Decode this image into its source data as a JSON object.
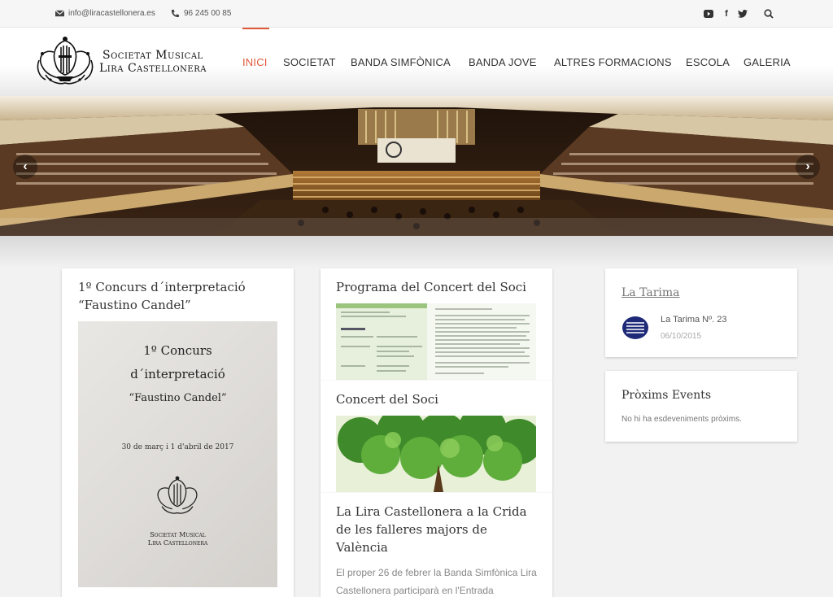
{
  "topbar": {
    "email": "info@liracastellonera.es",
    "phone": "96 245 00 85",
    "icons": [
      "youtube-icon",
      "facebook-icon",
      "twitter-icon",
      "search-icon"
    ]
  },
  "logo": {
    "line1": "Societat Musical",
    "line2": "Lira Castellonera"
  },
  "nav": {
    "items": [
      "INICI",
      "SOCIETAT",
      "BANDA SIMFÒNICA",
      "BANDA JOVE",
      "ALTRES FORMACIONS",
      "ESCOLA",
      "GALERIA"
    ],
    "active_color": "#e0583b"
  },
  "posts": {
    "concurs": {
      "title": "1º Concurs d´interpretació “Faustino Candel”",
      "poster": {
        "line1": "1º Concurs",
        "line2": "d´interpretació",
        "line3": "“Faustino Candel”",
        "dates": "30 de març i 1 d'abril de 2017",
        "org1": "Societat Musical",
        "org2": "Lira Castellonera"
      }
    },
    "programa": {
      "title": "Programa del Concert del Soci"
    },
    "concert": {
      "title": "Concert del Soci"
    },
    "crida": {
      "title": "La Lira Castellonera a la Crida de les falleres majors de València",
      "excerpt": "El proper 26 de febrer la Banda Simfònica Lira Castellonera participarà en l'Entrada"
    }
  },
  "sidebar": {
    "tarima": {
      "title": "La Tarima",
      "item_title": "La Tarima Nº. 23",
      "item_date": "06/10/2015"
    },
    "events": {
      "title": "Pròxims Events",
      "empty": "No hi ha esdeveniments pròxims."
    }
  }
}
